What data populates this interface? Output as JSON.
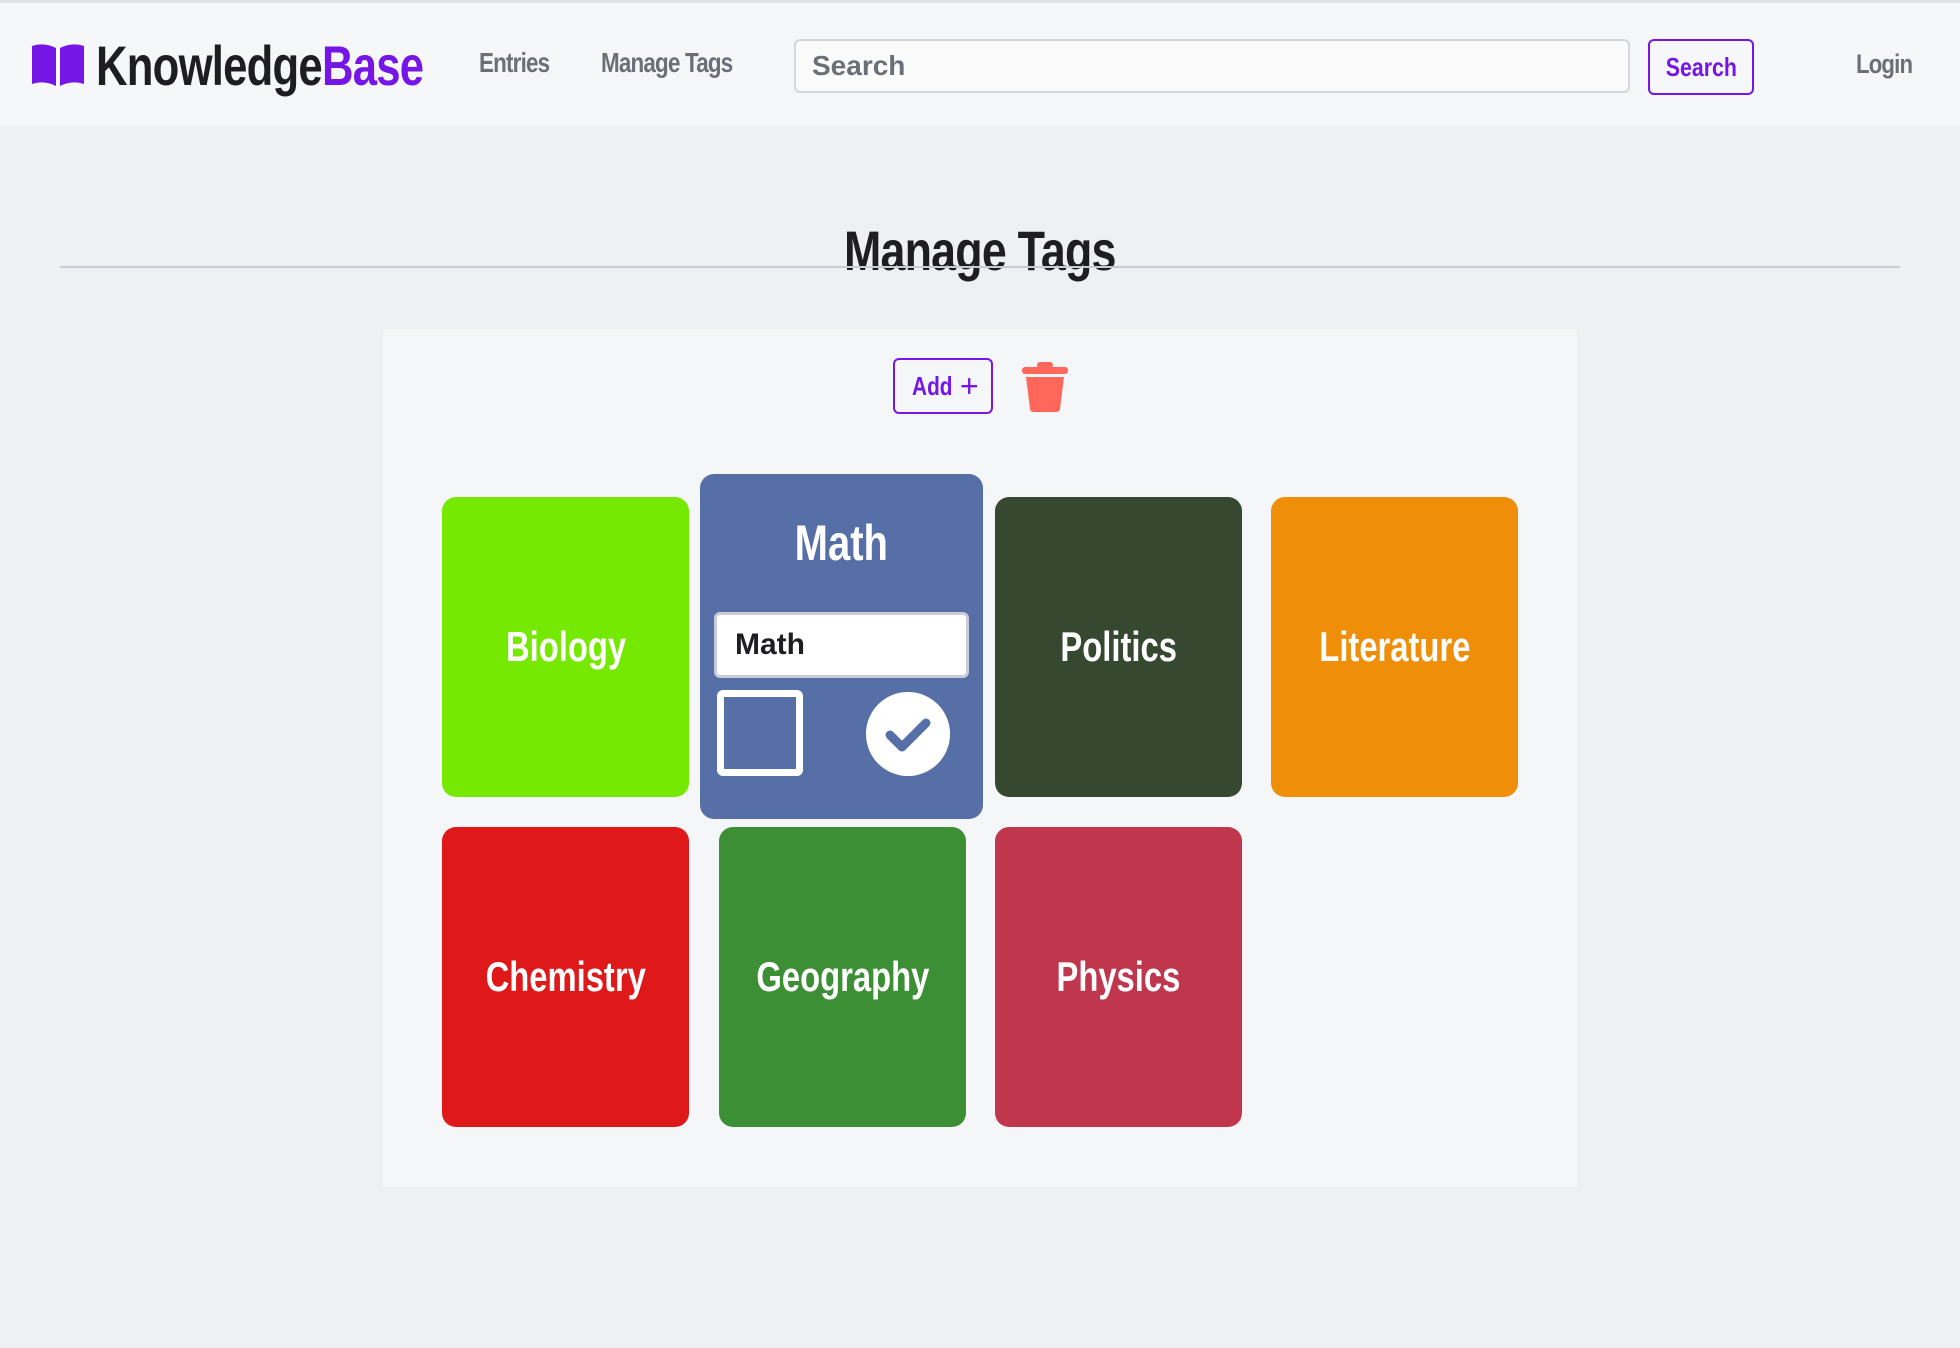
{
  "header": {
    "brand_part1": "Knowledge",
    "brand_part2": "Base",
    "nav": [
      {
        "label": "Entries"
      },
      {
        "label": "Manage Tags"
      }
    ],
    "search_placeholder": "Search",
    "search_button": "Search",
    "login": "Login"
  },
  "page": {
    "title": "Manage Tags"
  },
  "toolbar": {
    "add_label": "Add",
    "add_icon": "plus-icon",
    "delete_icon": "trash-icon"
  },
  "editing_tag": {
    "title": "Math",
    "input_value": "Math",
    "color": "#566fa6"
  },
  "tags": [
    {
      "name": "Biology",
      "color": "#76e902"
    },
    {
      "name": "Politics",
      "color": "#36482f"
    },
    {
      "name": "Literature",
      "color": "#ef8e08"
    },
    {
      "name": "Chemistry",
      "color": "#df181a"
    },
    {
      "name": "Geography",
      "color": "#3d8f36"
    },
    {
      "name": "Physics",
      "color": "#c0364d"
    }
  ],
  "colors": {
    "accent": "#7516e7",
    "danger": "#ff675b",
    "page_bg": "#eff0f3"
  }
}
